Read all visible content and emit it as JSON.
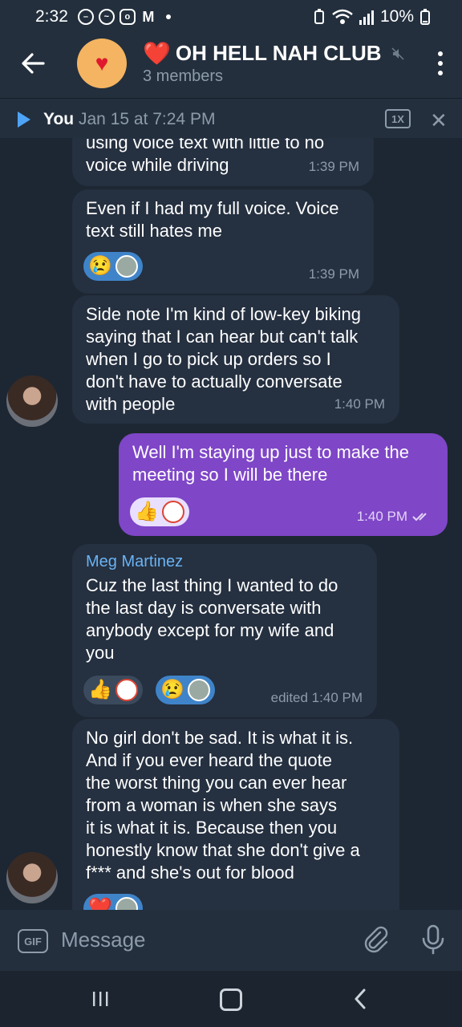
{
  "status": {
    "time": "2:32",
    "battery": "10%"
  },
  "header": {
    "title": "OH HELL NAH CLUB",
    "heart": "❤️",
    "subtitle": "3 members"
  },
  "player": {
    "name": "You",
    "date": "Jan 15 at 7:24 PM",
    "speed": "1X"
  },
  "messages": [
    {
      "text": "using voice text with little to no\nvoice while driving",
      "time": "1:39 PM"
    },
    {
      "text": "Even if I had my full voice. Voice\ntext still hates me",
      "time": "1:39 PM",
      "reaction": "😢"
    },
    {
      "text": "Side note I'm kind of low-key biking\nsaying that I can hear but can't talk\nwhen I go to pick up orders so I\ndon't have to actually conversate\nwith people",
      "time": "1:40 PM"
    },
    {
      "text": "Well I'm staying up just to make the\nmeeting so I will be there",
      "time": "1:40 PM",
      "reaction": "👍"
    },
    {
      "sender": "Meg Martinez",
      "text": "Cuz the last thing I wanted to do\nthe last day is conversate with\nanybody except for my wife and\nyou",
      "time": "edited 1:40 PM",
      "reaction1": "👍",
      "reaction2": "😢"
    },
    {
      "text": "No girl don't be sad. It is what it is.\nAnd if you ever heard the quote\nthe worst thing you can ever hear\nfrom a woman is when she says\nit is what it is. Because then you\nhonestly know that she don't give a\nf*** and she's out for blood",
      "reaction": "❤️"
    }
  ],
  "composer": {
    "gif": "GIF",
    "placeholder": "Message"
  },
  "colors": {
    "accent": "#6ab3f3",
    "outgoing": "#7f46c7",
    "incoming": "#253040",
    "background": "#1d2733"
  }
}
